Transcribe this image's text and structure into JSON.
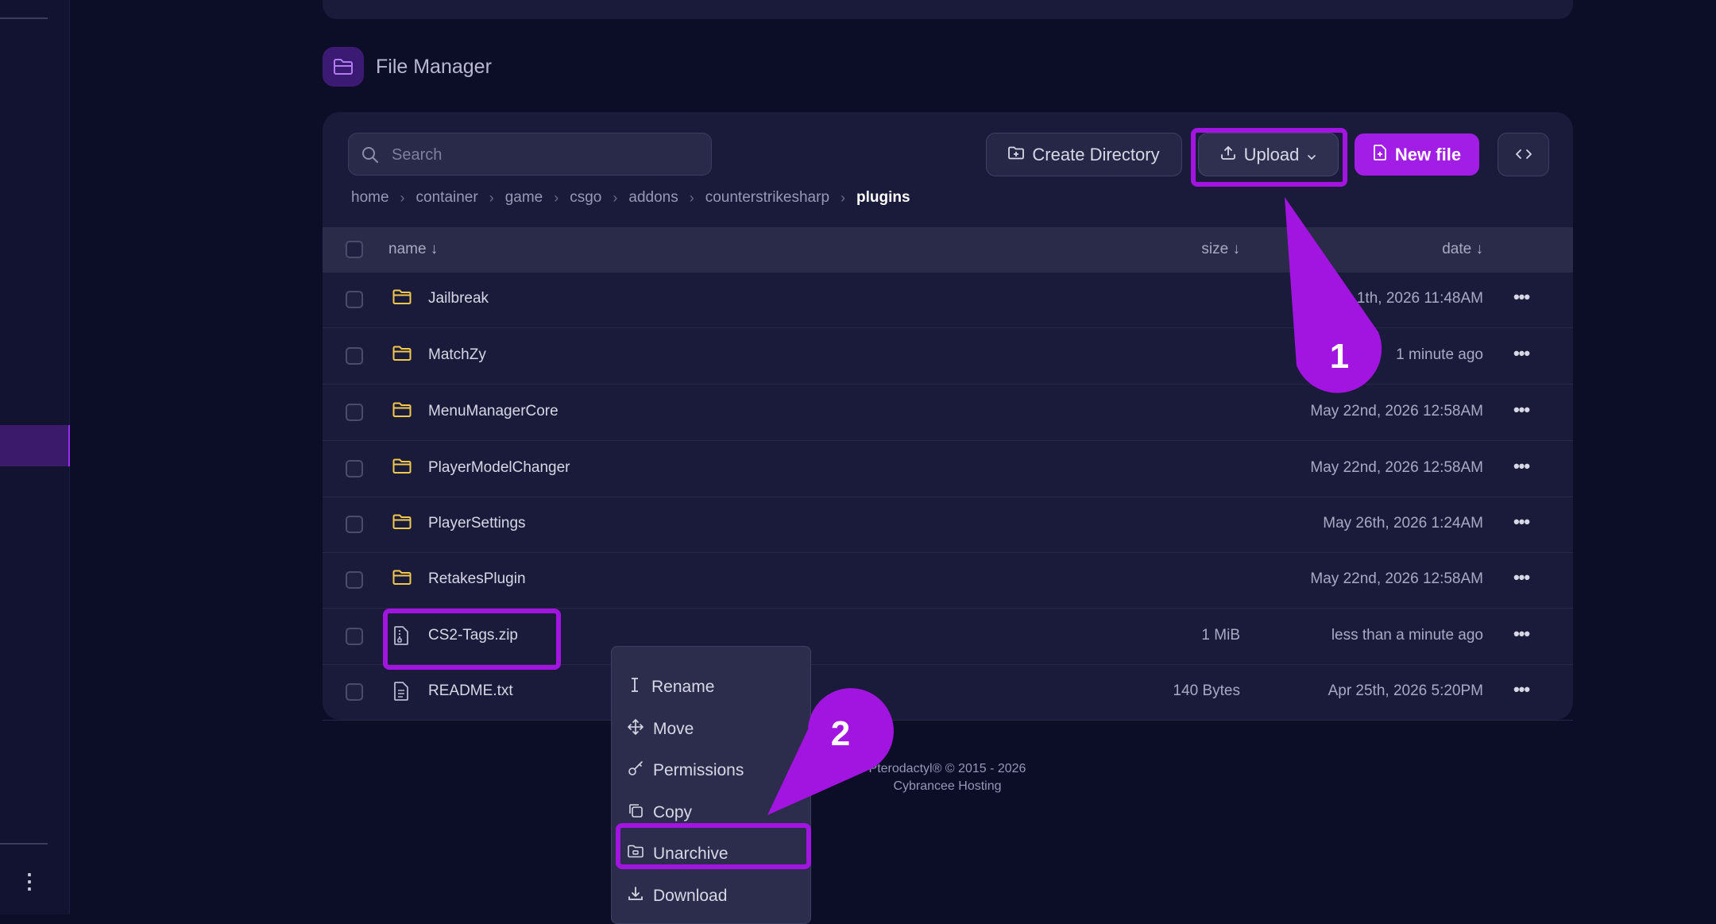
{
  "header": {
    "title": "File Manager"
  },
  "search": {
    "placeholder": "Search",
    "value": ""
  },
  "toolbar": {
    "create_directory": "Create Directory",
    "upload": "Upload",
    "new_file": "New file"
  },
  "breadcrumb": {
    "items": [
      "home",
      "container",
      "game",
      "csgo",
      "addons",
      "counterstrikesharp"
    ],
    "current": "plugins"
  },
  "table": {
    "columns": {
      "name": "name ↓",
      "size": "size ↓",
      "date": "date ↓"
    },
    "rows": [
      {
        "type": "folder",
        "name": "Jailbreak",
        "size": "",
        "date": "1th, 2026 11:48AM"
      },
      {
        "type": "folder",
        "name": "MatchZy",
        "size": "",
        "date": "1 minute ago"
      },
      {
        "type": "folder",
        "name": "MenuManagerCore",
        "size": "",
        "date": "May 22nd, 2026 12:58AM"
      },
      {
        "type": "folder",
        "name": "PlayerModelChanger",
        "size": "",
        "date": "May 22nd, 2026 12:58AM"
      },
      {
        "type": "folder",
        "name": "PlayerSettings",
        "size": "",
        "date": "May 26th, 2026 1:24AM"
      },
      {
        "type": "folder",
        "name": "RetakesPlugin",
        "size": "",
        "date": "May 22nd, 2026 12:58AM"
      },
      {
        "type": "archive",
        "name": "CS2-Tags.zip",
        "size": "1 MiB",
        "date": "less than a minute ago"
      },
      {
        "type": "text",
        "name": "README.txt",
        "size": "140 Bytes",
        "date": "Apr 25th, 2026 5:20PM"
      }
    ]
  },
  "context_menu": {
    "items": [
      {
        "label": "Rename",
        "icon": "text-cursor-icon"
      },
      {
        "label": "Move",
        "icon": "move-arrows-icon"
      },
      {
        "label": "Permissions",
        "icon": "key-icon"
      },
      {
        "label": "Copy",
        "icon": "copy-icon"
      },
      {
        "label": "Unarchive",
        "icon": "folder-unarchive-icon"
      },
      {
        "label": "Download",
        "icon": "download-icon"
      }
    ]
  },
  "footer": {
    "line1": "Pterodactyl® © 2015 - 2026",
    "line2": "Cybrancee Hosting"
  },
  "annotations": {
    "step1": "1",
    "step2": "2"
  },
  "colors": {
    "accent": "#a21de6",
    "highlight": "#a214e0",
    "folder": "#f2c94c",
    "background": "#0c0d26",
    "card": "#1a1b3a"
  }
}
